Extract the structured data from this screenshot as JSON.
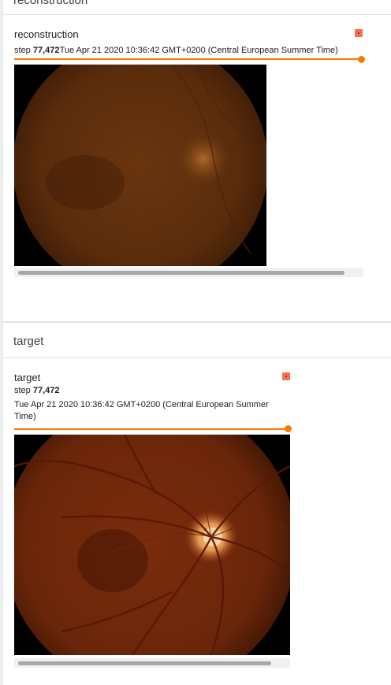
{
  "sections": [
    {
      "title": "reconstruction",
      "card": {
        "tag": "reconstruction",
        "step_label": "step",
        "step_value": "77,472",
        "wall_time": "Tue Apr 21 2020 10:36:42 GMT+0200 (Central European Summer Time)",
        "slider_fraction": 1.0
      }
    },
    {
      "title": "target",
      "card": {
        "tag": "target",
        "step_label": "step",
        "step_value": "77,472",
        "wall_time": "Tue Apr 21 2020 10:36:42 GMT+0200 (Central European Summer Time)",
        "slider_fraction": 1.0
      }
    }
  ],
  "colors": {
    "accent": "#f57c00",
    "pin": "#f4704e",
    "background": "#eeeeee"
  },
  "icons": {
    "pin": "pin-icon"
  }
}
